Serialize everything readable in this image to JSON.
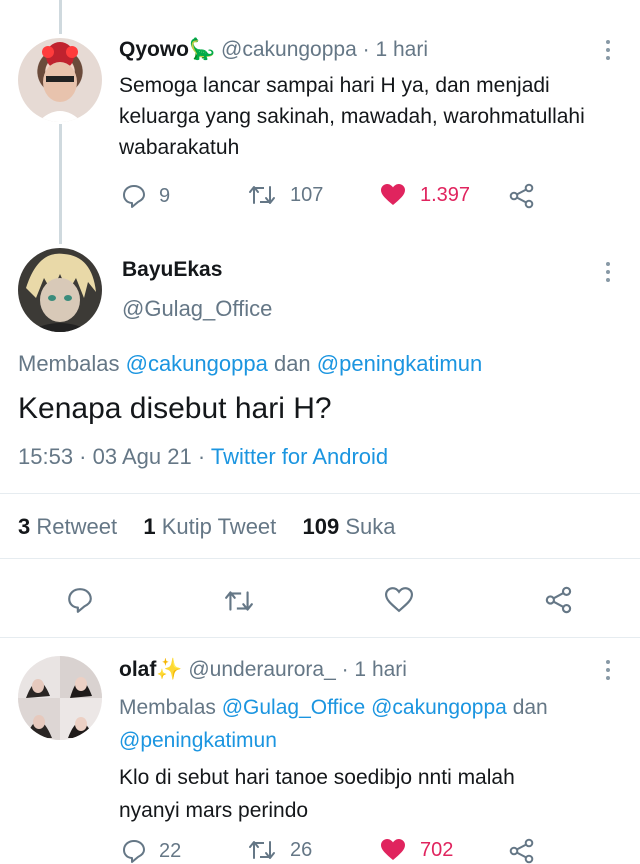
{
  "tweet1": {
    "display_name": "Qyowo",
    "emoji": "🦕",
    "handle": "@cakungoppa",
    "time": "· 1 hari",
    "text": "Semoga lancar sampai hari H ya, dan menjadi keluarga yang sakinah, mawadah, warohmatullahi wabarakatuh",
    "replies": "9",
    "retweets": "107",
    "likes": "1.397",
    "liked": true
  },
  "tweet2": {
    "display_name": "BayuEkas",
    "handle": "@Gulag_Office",
    "reply_prefix": "Membalas",
    "reply_user1": "@cakungoppa",
    "reply_and": "dan",
    "reply_user2": "@peningkatimun",
    "text": "Kenapa disebut hari H?",
    "timestamp": "15:53 · 03 Agu 21 ·",
    "source": "Twitter for Android",
    "stats": {
      "retweet_count": "3",
      "retweet_label": "Retweet",
      "quote_count": "1",
      "quote_label": "Kutip Tweet",
      "like_count": "109",
      "like_label": "Suka"
    }
  },
  "tweet3": {
    "display_name": "olaf",
    "emoji": "✨",
    "handle": "@underaurora_",
    "time": "· 1 hari",
    "reply_prefix": "Membalas",
    "reply_user1": "@Gulag_Office",
    "reply_user2": "@cakungoppa",
    "reply_and": "dan",
    "reply_user3": "@peningkatimun",
    "text_line1": "Klo di sebut hari tanoe soedibjo nnti malah",
    "text_line2": "nyanyi mars perindo",
    "replies": "22",
    "retweets": "26",
    "likes": "702"
  },
  "colors": {
    "link": "#1b95e0",
    "like_red": "#e0245e",
    "muted": "#657786"
  }
}
